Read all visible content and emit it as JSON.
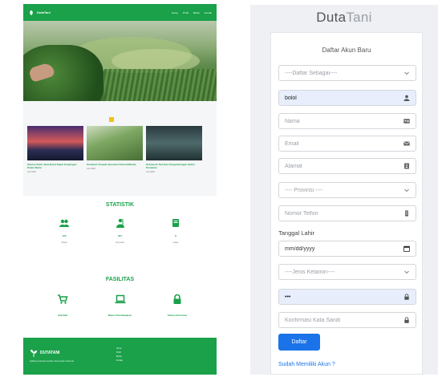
{
  "site": {
    "brand": "DutaTani",
    "nav": [
      "Home",
      "Profil",
      "Berita",
      "Kontak"
    ],
    "news": [
      {
        "title": "Stasiun Bumi Jawa Barat Dapat Kunjungan Petani Muda",
        "meta": "Juni 2020"
      },
      {
        "title": "Pertanian Terpadu Bersama Petani Milenial",
        "meta": "Juni 2020"
      },
      {
        "title": "Kelompok Tani Dan Pengembangan Sektor Pertanian",
        "meta": "Juni 2020"
      }
    ],
    "statistik": {
      "title": "STATISTIK",
      "items": [
        {
          "icon": "users-icon",
          "value": "105",
          "label": "Petani"
        },
        {
          "icon": "farmer-icon",
          "value": "597",
          "label": "Penyuluh"
        },
        {
          "icon": "book-icon",
          "value": "8",
          "label": "Lahan"
        }
      ]
    },
    "fasilitas": {
      "title": "FASILITAS",
      "items": [
        {
          "icon": "cart-icon",
          "label": "Jual Beli"
        },
        {
          "icon": "laptop-icon",
          "label": "Materi Pembelajaran"
        },
        {
          "icon": "lock-icon",
          "label": "Sistem Informasi"
        }
      ]
    },
    "footer": {
      "brand": "DUTATANI",
      "desc": "Aplikasi pertanian terpadu untuk petani Indonesia",
      "links": [
        "Home",
        "Profil",
        "Berita",
        "Kontak"
      ]
    }
  },
  "form": {
    "logo_bold": "Duta",
    "logo_light": "Tani",
    "title": "Daftar Akun Baru",
    "role_select": "----Daftar Sebagai----",
    "username_value": "bolol",
    "nama_placeholder": "Nama",
    "email_placeholder": "Email",
    "alamat_placeholder": "Alamat",
    "provinsi_select": "---- Provinsi ----",
    "telfon_placeholder": "Nomor Telfon",
    "tanggal_label": "Tanggal Lahir",
    "tanggal_placeholder": "mm/dd/yyyy",
    "gender_select": "----Jenis Kelamin----",
    "password_value": "•••",
    "konfirmasi_placeholder": "Konfirmasi Kata Sandi",
    "submit_label": "Daftar",
    "login_link": "Sudah Memiliki Akun ?"
  },
  "colors": {
    "green": "#1aa14a",
    "blue": "#1a73e8",
    "yellow": "#f1c21b"
  }
}
